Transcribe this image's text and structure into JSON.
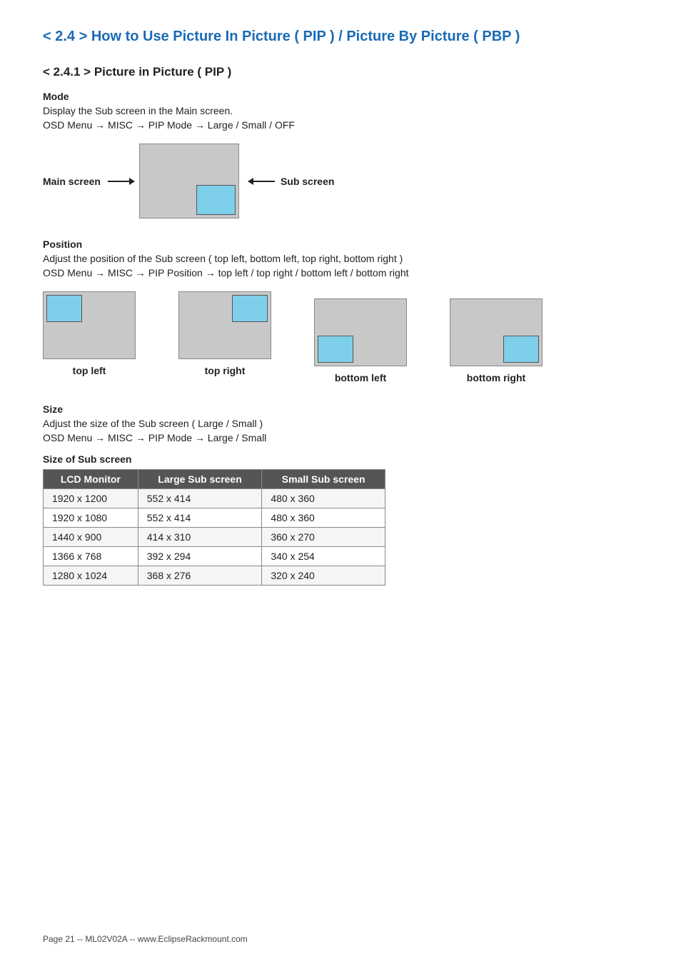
{
  "page": {
    "title": "< 2.4 > How to Use Picture In Picture ( PIP )  /  Picture By Picture ( PBP )",
    "section_2_4_1": "< 2.4.1 > Picture in Picture ( PIP )",
    "mode": {
      "label": "Mode",
      "line1": "Display the Sub screen in the Main screen.",
      "line2": "OSD Menu → MISC → PIP Mode → Large / Small / OFF"
    },
    "main_screen_label": "Main screen",
    "sub_screen_label": "Sub screen",
    "position": {
      "label": "Position",
      "line1": "Adjust the position of the Sub screen  ( top left, bottom left, top right, bottom right )",
      "line2": "OSD Menu → MISC → PIP Position → top left / top right / bottom left /  bottom right",
      "diagrams": [
        {
          "id": "top-left",
          "label": "top left",
          "pos": "top-left"
        },
        {
          "id": "top-right",
          "label": "top right",
          "pos": "top-right"
        },
        {
          "id": "bottom-left",
          "label": "bottom left",
          "pos": "bottom-left"
        },
        {
          "id": "bottom-right",
          "label": "bottom right",
          "pos": "bottom-right"
        }
      ]
    },
    "size": {
      "label": "Size",
      "line1": "Adjust the size of the Sub screen  ( Large / Small )",
      "line2": "OSD Menu → MISC → PIP Mode → Large / Small",
      "table_label": "Size of Sub screen",
      "table": {
        "headers": [
          "LCD Monitor",
          "Large Sub screen",
          "Small Sub screen"
        ],
        "rows": [
          [
            "1920 x 1200",
            "552 x 414",
            "480 x 360"
          ],
          [
            "1920 x 1080",
            "552 x 414",
            "480 x 360"
          ],
          [
            "1440 x 900",
            "414 x 310",
            "360 x 270"
          ],
          [
            "1366 x 768",
            "392 x 294",
            "340 x 254"
          ],
          [
            "1280 x 1024",
            "368 x 276",
            "320 x 240"
          ]
        ]
      }
    },
    "footer": "Page 21 -- ML02V02A -- www.EclipseRackmount.com"
  }
}
